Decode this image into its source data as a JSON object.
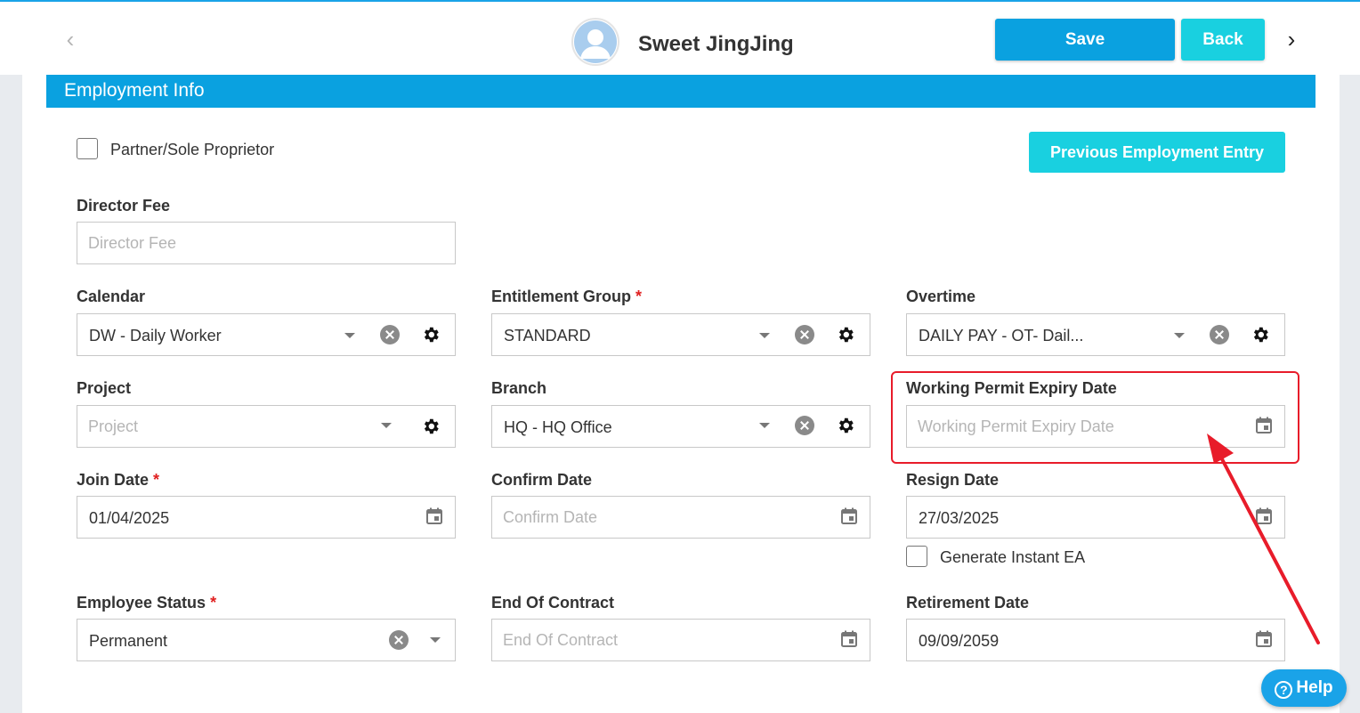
{
  "header": {
    "employee_name": "Sweet JingJing",
    "save_label": "Save",
    "back_label": "Back",
    "prev_glyph": "‹",
    "next_glyph": "›"
  },
  "section": {
    "title": "Employment Info"
  },
  "partner": {
    "label": "Partner/Sole Proprietor",
    "checked": false
  },
  "previous_employment_button": "Previous Employment Entry",
  "fields": {
    "director_fee": {
      "label": "Director Fee",
      "placeholder": "Director Fee",
      "value": ""
    },
    "calendar": {
      "label": "Calendar",
      "value": "DW - Daily Worker"
    },
    "entitlement_group": {
      "label": "Entitlement Group",
      "required_mark": "*",
      "value": "STANDARD"
    },
    "overtime": {
      "label": "Overtime",
      "value": "DAILY PAY - OT- Dail..."
    },
    "project": {
      "label": "Project",
      "placeholder": "Project",
      "value": ""
    },
    "branch": {
      "label": "Branch",
      "value": "HQ - HQ Office"
    },
    "working_permit_expiry_date": {
      "label": "Working Permit Expiry Date",
      "placeholder": "Working Permit Expiry Date",
      "value": ""
    },
    "join_date": {
      "label": "Join Date",
      "required_mark": "*",
      "value": "01/04/2025"
    },
    "confirm_date": {
      "label": "Confirm Date",
      "placeholder": "Confirm Date",
      "value": ""
    },
    "resign_date": {
      "label": "Resign Date",
      "value": "27/03/2025"
    },
    "employee_status": {
      "label": "Employee Status",
      "required_mark": "*",
      "value": "Permanent"
    },
    "end_of_contract": {
      "label": "End Of Contract",
      "placeholder": "End Of Contract",
      "value": ""
    },
    "retirement_date": {
      "label": "Retirement Date",
      "value": "09/09/2059"
    }
  },
  "generate_instant_ea": {
    "label": "Generate Instant EA",
    "checked": false
  },
  "help": {
    "label": "Help",
    "icon_glyph": "?"
  },
  "colors": {
    "primary": "#0aa1e0",
    "accent": "#19d0e0",
    "required": "#e02020",
    "annotation": "#e81c2a"
  }
}
